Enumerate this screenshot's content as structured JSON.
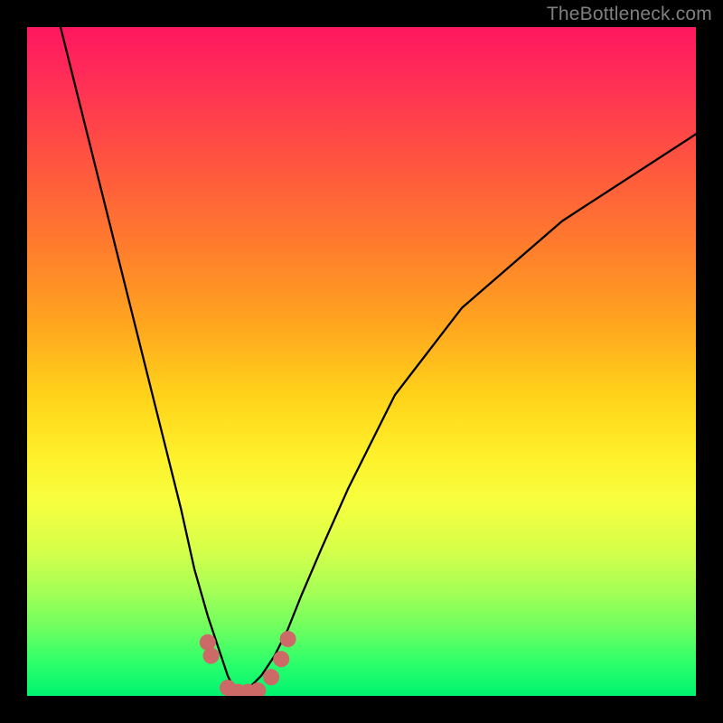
{
  "watermark": "TheBottleneck.com",
  "chart_data": {
    "type": "line",
    "title": "",
    "xlabel": "",
    "ylabel": "",
    "xlim": [
      0,
      100
    ],
    "ylim": [
      0,
      100
    ],
    "grid": false,
    "series": [
      {
        "name": "bottleneck-curve",
        "x": [
          5,
          8,
          11,
          14,
          17,
          20,
          23,
          25,
          27,
          29,
          30,
          31,
          32,
          33,
          35,
          37,
          39,
          41,
          44,
          48,
          55,
          65,
          80,
          100
        ],
        "values": [
          100,
          88,
          76,
          64,
          52,
          40,
          28,
          19,
          12,
          6,
          3,
          1,
          0,
          1,
          3,
          6,
          10,
          15,
          22,
          31,
          45,
          58,
          71,
          84
        ]
      }
    ],
    "markers": {
      "name": "bottom-dots",
      "color": "#cb6a67",
      "points": [
        {
          "x": 27.0,
          "y": 8.0
        },
        {
          "x": 27.5,
          "y": 6.0
        },
        {
          "x": 30.0,
          "y": 1.2
        },
        {
          "x": 31.5,
          "y": 0.6
        },
        {
          "x": 33.0,
          "y": 0.6
        },
        {
          "x": 34.5,
          "y": 0.8
        },
        {
          "x": 36.5,
          "y": 2.8
        },
        {
          "x": 38.0,
          "y": 5.5
        },
        {
          "x": 39.0,
          "y": 8.5
        }
      ]
    },
    "background_gradient": {
      "direction": "top-to-bottom",
      "stops": [
        {
          "pos": 0.0,
          "color": "#ff1760"
        },
        {
          "pos": 0.2,
          "color": "#ff5440"
        },
        {
          "pos": 0.44,
          "color": "#ffa41f"
        },
        {
          "pos": 0.64,
          "color": "#fff02a"
        },
        {
          "pos": 0.84,
          "color": "#a8ff55"
        },
        {
          "pos": 1.0,
          "color": "#00f470"
        }
      ]
    }
  }
}
